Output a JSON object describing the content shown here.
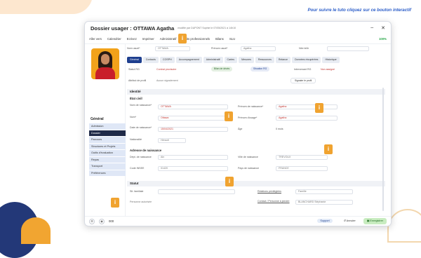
{
  "tagline": "Pour suivre le tuto cliquez sur ce bouton interactif",
  "window": {
    "title": "Dossier usager : OTTAWA Agatha",
    "subtitle": "modifié par DUPONT Sophie le 07/05/2021 à 14h10"
  },
  "toolbar": {
    "items": [
      "Aller vers",
      "Calendrier",
      "Ecrivez",
      "Imprimer",
      "Administratif",
      "Écrits professionnels",
      "Bilans",
      "SLU"
    ],
    "progress": "100%"
  },
  "header": {
    "nom_label": "Nom usuel*",
    "nom_value": "OTTAWA",
    "prenom_label": "Prénom usuel*",
    "prenom_value": "Agatha",
    "naiss_label": "Née le/le"
  },
  "tabs": [
    "Général",
    "Contacts",
    "COSPH",
    "Accompagnement",
    "Administratif",
    "Cartes",
    "Mesures",
    "Ressources",
    "Relance",
    "Données récupérées",
    "Historique"
  ],
  "status": {
    "statut_label": "Statut RG",
    "statut_value": "Contrat provisoire",
    "badge1": "Bilan de décès",
    "badge2": "Situation RG",
    "intervenant_label": "Intervenant RG",
    "intervenant_value": "Non assigné",
    "profil_label": "Attribut de profil",
    "profil_value": "Aucun signalement",
    "profil_btn": "Signaler le profil"
  },
  "nav": {
    "heading": "Général",
    "items": [
      "Admission",
      "Dossier",
      "Parcours",
      "Structures et Projets",
      "Outils d'évaluation",
      "Repas",
      "Transport",
      "Préférences"
    ]
  },
  "identite": {
    "section": "Identité",
    "etat_civil": "État civil",
    "nom_naiss_label": "Nom de naissance*",
    "nom_naiss_value": "OTTAWA",
    "prenom_naiss_label": "Prénom de naissance*",
    "prenom_naiss_value": "Agatha",
    "nom2_label": "Nom*",
    "nom2_value": "Ottawa",
    "prenom2_label": "Prénom d'usage*",
    "prenom2_value": "Agatha",
    "date_label": "Date de naissance*",
    "date_value": "15/04/2021",
    "age_label": "Âge",
    "age_value": "0 mois",
    "nat_label": "Nationalité",
    "nat_value": "Hérault",
    "adresse": "Adresse de naissance",
    "dept_label": "Dépt. de naissance",
    "dept_value": "Ain",
    "ville_label": "Ville de naissance",
    "ville_value": "TREVOUX",
    "cp_label": "Code INSEE",
    "cp_value": "01420",
    "pays_label": "Pays de naissance",
    "pays_value": "FRANCE"
  },
  "statut": {
    "section": "Statut",
    "sit_label": "Sit. familiale",
    "sit_value": "",
    "rel_label": "Relations privilégiées",
    "rel_value": "Famille",
    "resp_label": "Personne autorisée",
    "resp2_label": "Contact / Personne à joindre",
    "resp2_value": "BLANCHARD Stéphanie"
  },
  "bottom": {
    "left": "000",
    "support": "Support",
    "annuler": "Annuler",
    "enregistrer": "Enregistrer"
  },
  "colors": {
    "accent": "#1e3f8f",
    "info": "#f0a330",
    "save": "#c8ecc0"
  },
  "info_icon": "i"
}
